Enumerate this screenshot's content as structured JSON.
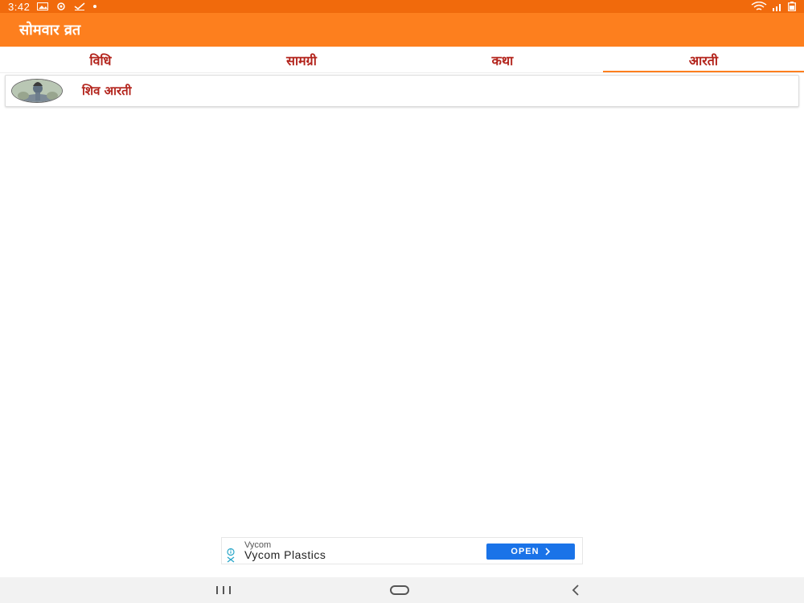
{
  "status_bar": {
    "time": "3:42",
    "left_icons": [
      "image-icon",
      "sync-icon",
      "check-icon",
      "dot-icon"
    ],
    "right_icons": [
      "wifi-icon",
      "signal-icon",
      "battery-icon"
    ]
  },
  "app_bar": {
    "title": "सोमवार व्रत"
  },
  "tabs": [
    {
      "label": "विधि",
      "active": false
    },
    {
      "label": "सामग्री",
      "active": false
    },
    {
      "label": "कथा",
      "active": false
    },
    {
      "label": "आरती",
      "active": true
    }
  ],
  "list": {
    "items": [
      {
        "label": "शिव आरती",
        "icon": "shiva-avatar"
      }
    ]
  },
  "ad": {
    "advertiser": "Vycom",
    "headline": "Vycom Plastics",
    "cta": "OPEN",
    "icons": [
      "info-icon",
      "close-icon"
    ]
  },
  "nav_bar": {
    "buttons": [
      "recents-icon",
      "home-icon",
      "back-icon"
    ]
  },
  "colors": {
    "status_bar": "#f16a0c",
    "app_bar": "#fd7f1e",
    "tab_text": "#b3241c",
    "accent": "#fd7f1e",
    "cta": "#1a73e8"
  }
}
